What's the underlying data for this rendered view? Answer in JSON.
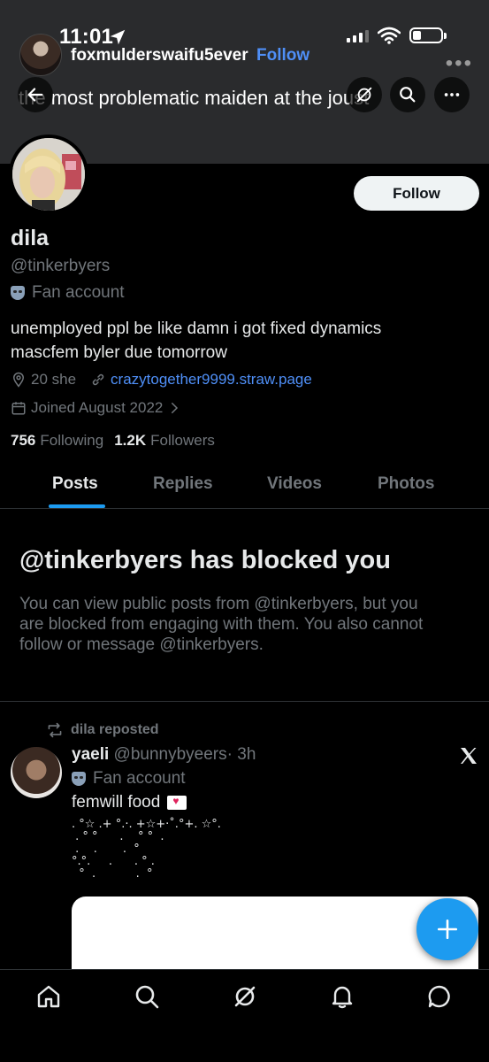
{
  "status_bar": {
    "time": "11:01"
  },
  "reel": {
    "username": "foxmulderswaifu5ever",
    "follow_label": "Follow",
    "caption": "the most problematic maiden at the joust",
    "more": "•••"
  },
  "profile": {
    "follow_label": "Follow",
    "name": "dila",
    "handle": "@tinkerbyers",
    "category": "Fan account",
    "bio_lines": [
      "unemployed ppl be like damn i got fixed dynamics",
      "mascfem byler due tomorrow"
    ],
    "location": "20 she",
    "link": "crazytogether9999.straw.page",
    "joined": "Joined August 2022",
    "following_count": "756",
    "following_label": "Following",
    "followers_count": "1.2K",
    "followers_label": "Followers"
  },
  "tabs": [
    {
      "label": "Posts",
      "active": true
    },
    {
      "label": "Replies",
      "active": false
    },
    {
      "label": "Videos",
      "active": false
    },
    {
      "label": "Photos",
      "active": false
    }
  ],
  "blocked": {
    "title": "@tinkerbyers has blocked you",
    "lines": [
      "You can view public posts from @tinkerbyers, but you",
      "are blocked from engaging with them. You also cannot",
      "follow or message @tinkerbyers."
    ]
  },
  "post": {
    "repost_label": "dila reposted",
    "author_name": "yaeli",
    "author_handle": "@bunnybyeers",
    "time": "· 3h",
    "category": "Fan account",
    "text": "femwill food",
    "decoration": ". °☆ .+ °.·. +☆+·˚.°+. ☆°.\n . ° °      .    ° °  .\n .    .       .  °\n°.°.     .      . ° .\n  °  .           .  °"
  },
  "colors": {
    "accent": "#1d9bf0",
    "link": "#4f8ff7",
    "background": "#000000",
    "header_bg": "#2a2b2d",
    "muted": "#71767b"
  }
}
